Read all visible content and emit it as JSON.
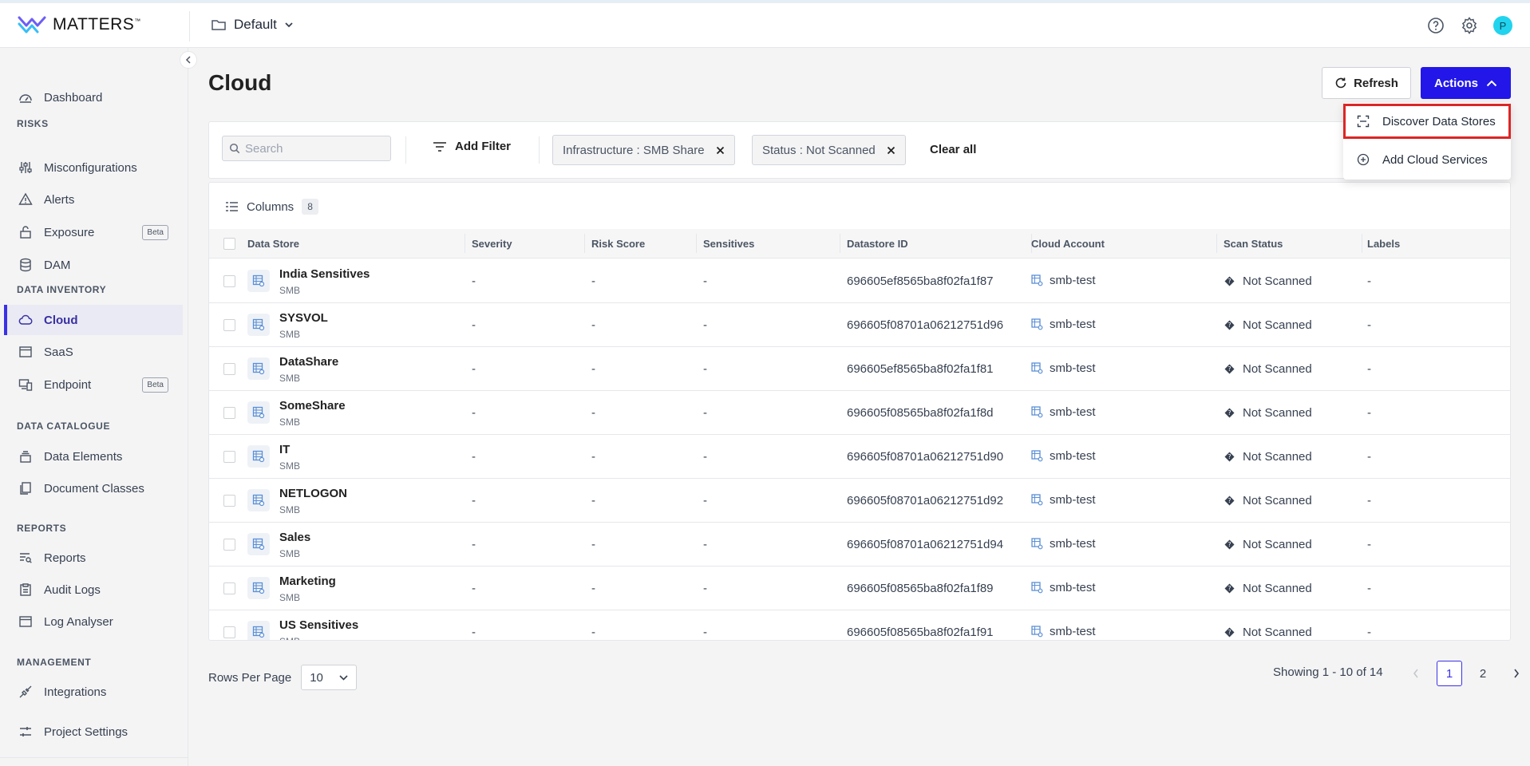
{
  "app": {
    "brand": "MATTERS",
    "brand_tm": "™",
    "project": "Default"
  },
  "sidebar": {
    "items": [
      {
        "label": "Dashboard",
        "icon": "dashboard-icon"
      },
      {
        "label": "Misconfigurations",
        "icon": "sliders-icon"
      },
      {
        "label": "Alerts",
        "icon": "alert-triangle-icon"
      },
      {
        "label": "Exposure",
        "icon": "lock-icon",
        "badge": "Beta"
      },
      {
        "label": "DAM",
        "icon": "database-icon"
      },
      {
        "label": "Cloud",
        "icon": "cloud-icon",
        "active": true
      },
      {
        "label": "SaaS",
        "icon": "window-icon"
      },
      {
        "label": "Endpoint",
        "icon": "devices-icon",
        "badge": "Beta"
      },
      {
        "label": "Data Elements",
        "icon": "stack-icon"
      },
      {
        "label": "Document Classes",
        "icon": "documents-icon"
      },
      {
        "label": "Reports",
        "icon": "list-search-icon"
      },
      {
        "label": "Audit Logs",
        "icon": "clipboard-icon"
      },
      {
        "label": "Log Analyser",
        "icon": "window-icon"
      },
      {
        "label": "Integrations",
        "icon": "plug-icon"
      },
      {
        "label": "Project Settings",
        "icon": "settings-sliders-icon"
      }
    ],
    "sections": {
      "risks": "RISKS",
      "data_inventory": "DATA INVENTORY",
      "data_catalogue": "DATA CATALOGUE",
      "reports": "REPORTS",
      "management": "MANAGEMENT"
    }
  },
  "main": {
    "title": "Cloud",
    "refresh_label": "Refresh",
    "actions_label": "Actions",
    "actions_menu": [
      "Discover Data Stores",
      "Add Cloud Services"
    ],
    "search_placeholder": "Search",
    "add_filter_label": "Add Filter",
    "filters": [
      "Infrastructure : SMB Share",
      "Status : Not Scanned"
    ],
    "clear_all_label": "Clear all",
    "columns_label": "Columns",
    "columns_count": "8"
  },
  "table": {
    "headers": [
      "Data Store",
      "Severity",
      "Risk Score",
      "Sensitives",
      "Datastore ID",
      "Cloud Account",
      "Scan Status",
      "Labels"
    ],
    "rows": [
      {
        "name": "India Sensitives",
        "type": "SMB",
        "severity": "-",
        "risk": "-",
        "sensitives": "-",
        "id": "696605ef8565ba8f02fa1f87",
        "account": "smb-test",
        "status": "Not Scanned",
        "labels": "-"
      },
      {
        "name": "SYSVOL",
        "type": "SMB",
        "severity": "-",
        "risk": "-",
        "sensitives": "-",
        "id": "696605f08701a06212751d96",
        "account": "smb-test",
        "status": "Not Scanned",
        "labels": "-"
      },
      {
        "name": "DataShare",
        "type": "SMB",
        "severity": "-",
        "risk": "-",
        "sensitives": "-",
        "id": "696605ef8565ba8f02fa1f81",
        "account": "smb-test",
        "status": "Not Scanned",
        "labels": "-"
      },
      {
        "name": "SomeShare",
        "type": "SMB",
        "severity": "-",
        "risk": "-",
        "sensitives": "-",
        "id": "696605f08565ba8f02fa1f8d",
        "account": "smb-test",
        "status": "Not Scanned",
        "labels": "-"
      },
      {
        "name": "IT",
        "type": "SMB",
        "severity": "-",
        "risk": "-",
        "sensitives": "-",
        "id": "696605f08701a06212751d90",
        "account": "smb-test",
        "status": "Not Scanned",
        "labels": "-"
      },
      {
        "name": "NETLOGON",
        "type": "SMB",
        "severity": "-",
        "risk": "-",
        "sensitives": "-",
        "id": "696605f08701a06212751d92",
        "account": "smb-test",
        "status": "Not Scanned",
        "labels": "-"
      },
      {
        "name": "Sales",
        "type": "SMB",
        "severity": "-",
        "risk": "-",
        "sensitives": "-",
        "id": "696605f08701a06212751d94",
        "account": "smb-test",
        "status": "Not Scanned",
        "labels": "-"
      },
      {
        "name": "Marketing",
        "type": "SMB",
        "severity": "-",
        "risk": "-",
        "sensitives": "-",
        "id": "696605f08565ba8f02fa1f89",
        "account": "smb-test",
        "status": "Not Scanned",
        "labels": "-"
      },
      {
        "name": "US Sensitives",
        "type": "SMB",
        "severity": "-",
        "risk": "-",
        "sensitives": "-",
        "id": "696605f08565ba8f02fa1f91",
        "account": "smb-test",
        "status": "Not Scanned",
        "labels": "-"
      }
    ]
  },
  "footer": {
    "rows_per_page_label": "Rows Per Page",
    "rows_per_page_value": "10",
    "showing": "Showing 1 - 10 of 14",
    "pages": [
      "1",
      "2"
    ]
  },
  "colors": {
    "accent": "#2217e8",
    "highlight": "#dc2626",
    "avatar": "#22d3ee"
  }
}
